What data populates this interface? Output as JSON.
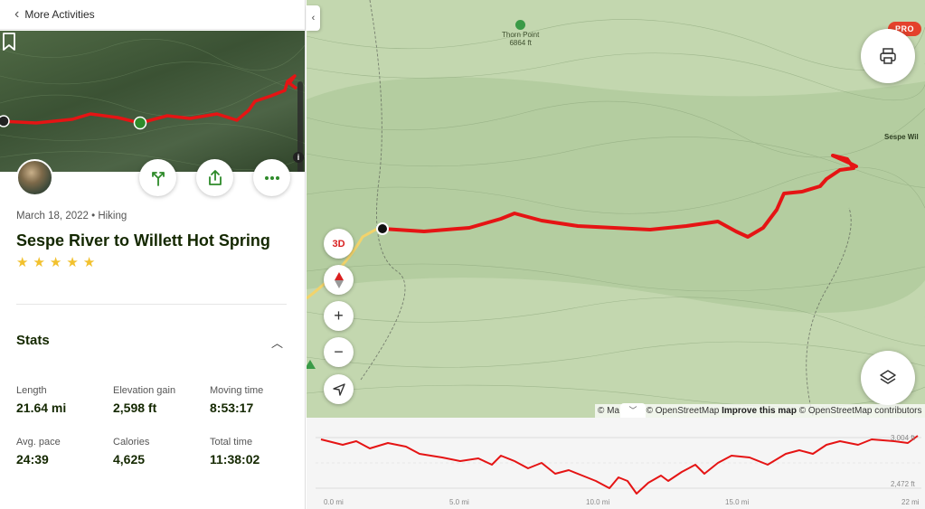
{
  "nav": {
    "back_label": "More Activities"
  },
  "activity": {
    "date_type": "March 18, 2022 • Hiking",
    "title": "Sespe River to Willett Hot Spring",
    "rating": 5
  },
  "stats": {
    "heading": "Stats",
    "items": [
      {
        "label": "Length",
        "value": "21.64 mi"
      },
      {
        "label": "Elevation gain",
        "value": "2,598 ft"
      },
      {
        "label": "Moving time",
        "value": "8:53:17"
      },
      {
        "label": "Avg. pace",
        "value": "24:39"
      },
      {
        "label": "Calories",
        "value": "4,625"
      },
      {
        "label": "Total time",
        "value": "11:38:02"
      }
    ]
  },
  "map": {
    "peak_name": "Thorn Point",
    "peak_elevation": "6864 ft",
    "edge_label": "Sespe Wil",
    "btn_3d": "3D",
    "pro_badge": "PRO",
    "attribution_prefix": "© Ma",
    "attribution_osm": "© OpenStreetMap",
    "attribution_improve": "Improve this map",
    "attribution_suffix": "© OpenStreetMap contributors",
    "track_color": "#e51414",
    "terrain_color": "#b4cda0"
  },
  "elevation": {
    "x_ticks": [
      "0.0 mi",
      "5.0 mi",
      "10.0 mi",
      "15.0 mi",
      "22 mi"
    ],
    "y_max_label": "3,004 ft",
    "y_min_label": "2,472 ft"
  }
}
